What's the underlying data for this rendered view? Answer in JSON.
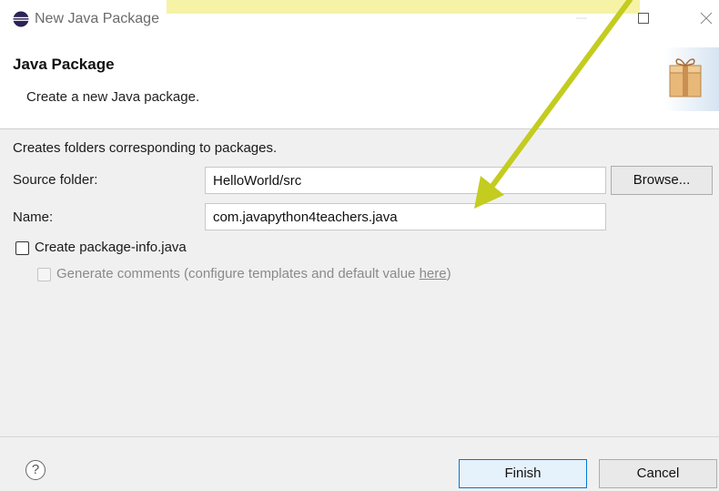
{
  "window": {
    "title": "New Java Package",
    "controls": [
      "minimize",
      "maximize",
      "close"
    ]
  },
  "header": {
    "title": "Java Package",
    "description": "Create a new Java package.",
    "icon": "package-icon"
  },
  "form": {
    "intro": "Creates folders corresponding to packages.",
    "source_folder_label": "Source folder:",
    "source_folder_value": "HelloWorld/src",
    "browse_label": "Browse...",
    "name_label": "Name:",
    "name_value": "com.javapython4teachers.java",
    "create_info_label": "Create package-info.java",
    "create_info_checked": false,
    "generate_comments_label": "Generate comments (configure templates and default value ",
    "generate_comments_link": "here",
    "generate_comments_suffix": ")",
    "generate_comments_checked": false,
    "generate_comments_enabled": false
  },
  "footer": {
    "help_label": "?",
    "finish_label": "Finish",
    "cancel_label": "Cancel"
  },
  "colors": {
    "annotation_arrow": "#c3cc1f",
    "title_highlight": "#f6f3a6",
    "primary_button_border": "#0078d7"
  }
}
